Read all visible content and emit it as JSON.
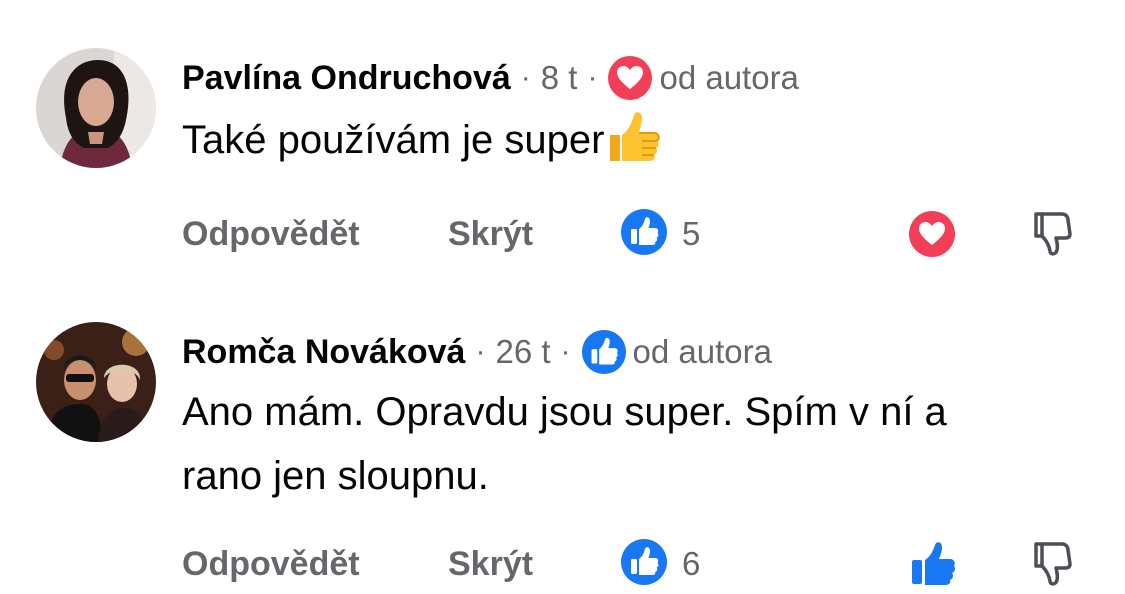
{
  "comments": [
    {
      "author": "Pavlína Ondruchová",
      "separator": "·",
      "time": "8 t",
      "badge_icon": "heart-reaction-icon",
      "badge_label": "od autora",
      "text": "Také používám je super",
      "emoji": "thumbs-up-emoji",
      "reply_label": "Odpovědět",
      "hide_label": "Skrýt",
      "like_count": "5",
      "reaction_icon": "heart-reaction-icon"
    },
    {
      "author": "Romča Nováková",
      "separator": "·",
      "time": "26 t",
      "badge_icon": "like-reaction-icon",
      "badge_label": "od autora",
      "text_line1": "Ano mám. Opravdu jsou super. Spím v ní a",
      "text_line2": "rano jen sloupnu.",
      "reply_label": "Odpovědět",
      "hide_label": "Skrýt",
      "like_count": "6",
      "reaction_icon": "like-outline-icon"
    }
  ],
  "colors": {
    "facebook_blue": "#1877F2",
    "heart_red": "#F33E58",
    "secondary_text": "#65676B",
    "primary_text": "#050505"
  }
}
